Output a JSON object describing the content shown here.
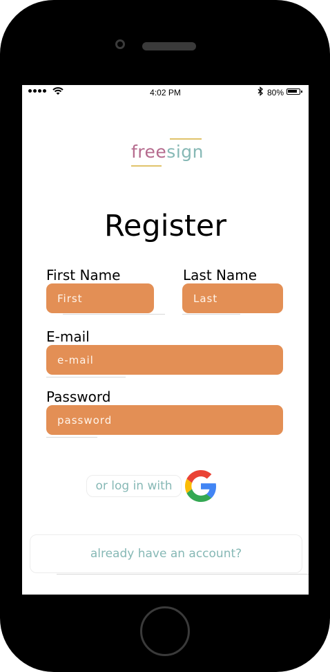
{
  "status_bar": {
    "time": "4:02 PM",
    "battery": "80%",
    "bluetooth_icon": "bluetooth-icon",
    "wifi_icon": "wifi-icon",
    "battery_icon": "battery-icon"
  },
  "logo": {
    "part1": "free",
    "part2": "sign",
    "colors": {
      "free": "#b56b8e",
      "sign": "#86b8b5",
      "accent": "#e0c36a"
    }
  },
  "title": "Register",
  "form": {
    "first_name": {
      "label": "First Name",
      "placeholder": "First",
      "value": ""
    },
    "last_name": {
      "label": "Last Name",
      "placeholder": "Last",
      "value": ""
    },
    "email": {
      "label": "E-mail",
      "placeholder": "e-mail",
      "value": ""
    },
    "password": {
      "label": "Password",
      "placeholder": "password",
      "value": ""
    },
    "input_color": "#e38f55"
  },
  "social": {
    "label": "or log in with",
    "provider_icon": "google-icon"
  },
  "account_link": "already have an account?"
}
